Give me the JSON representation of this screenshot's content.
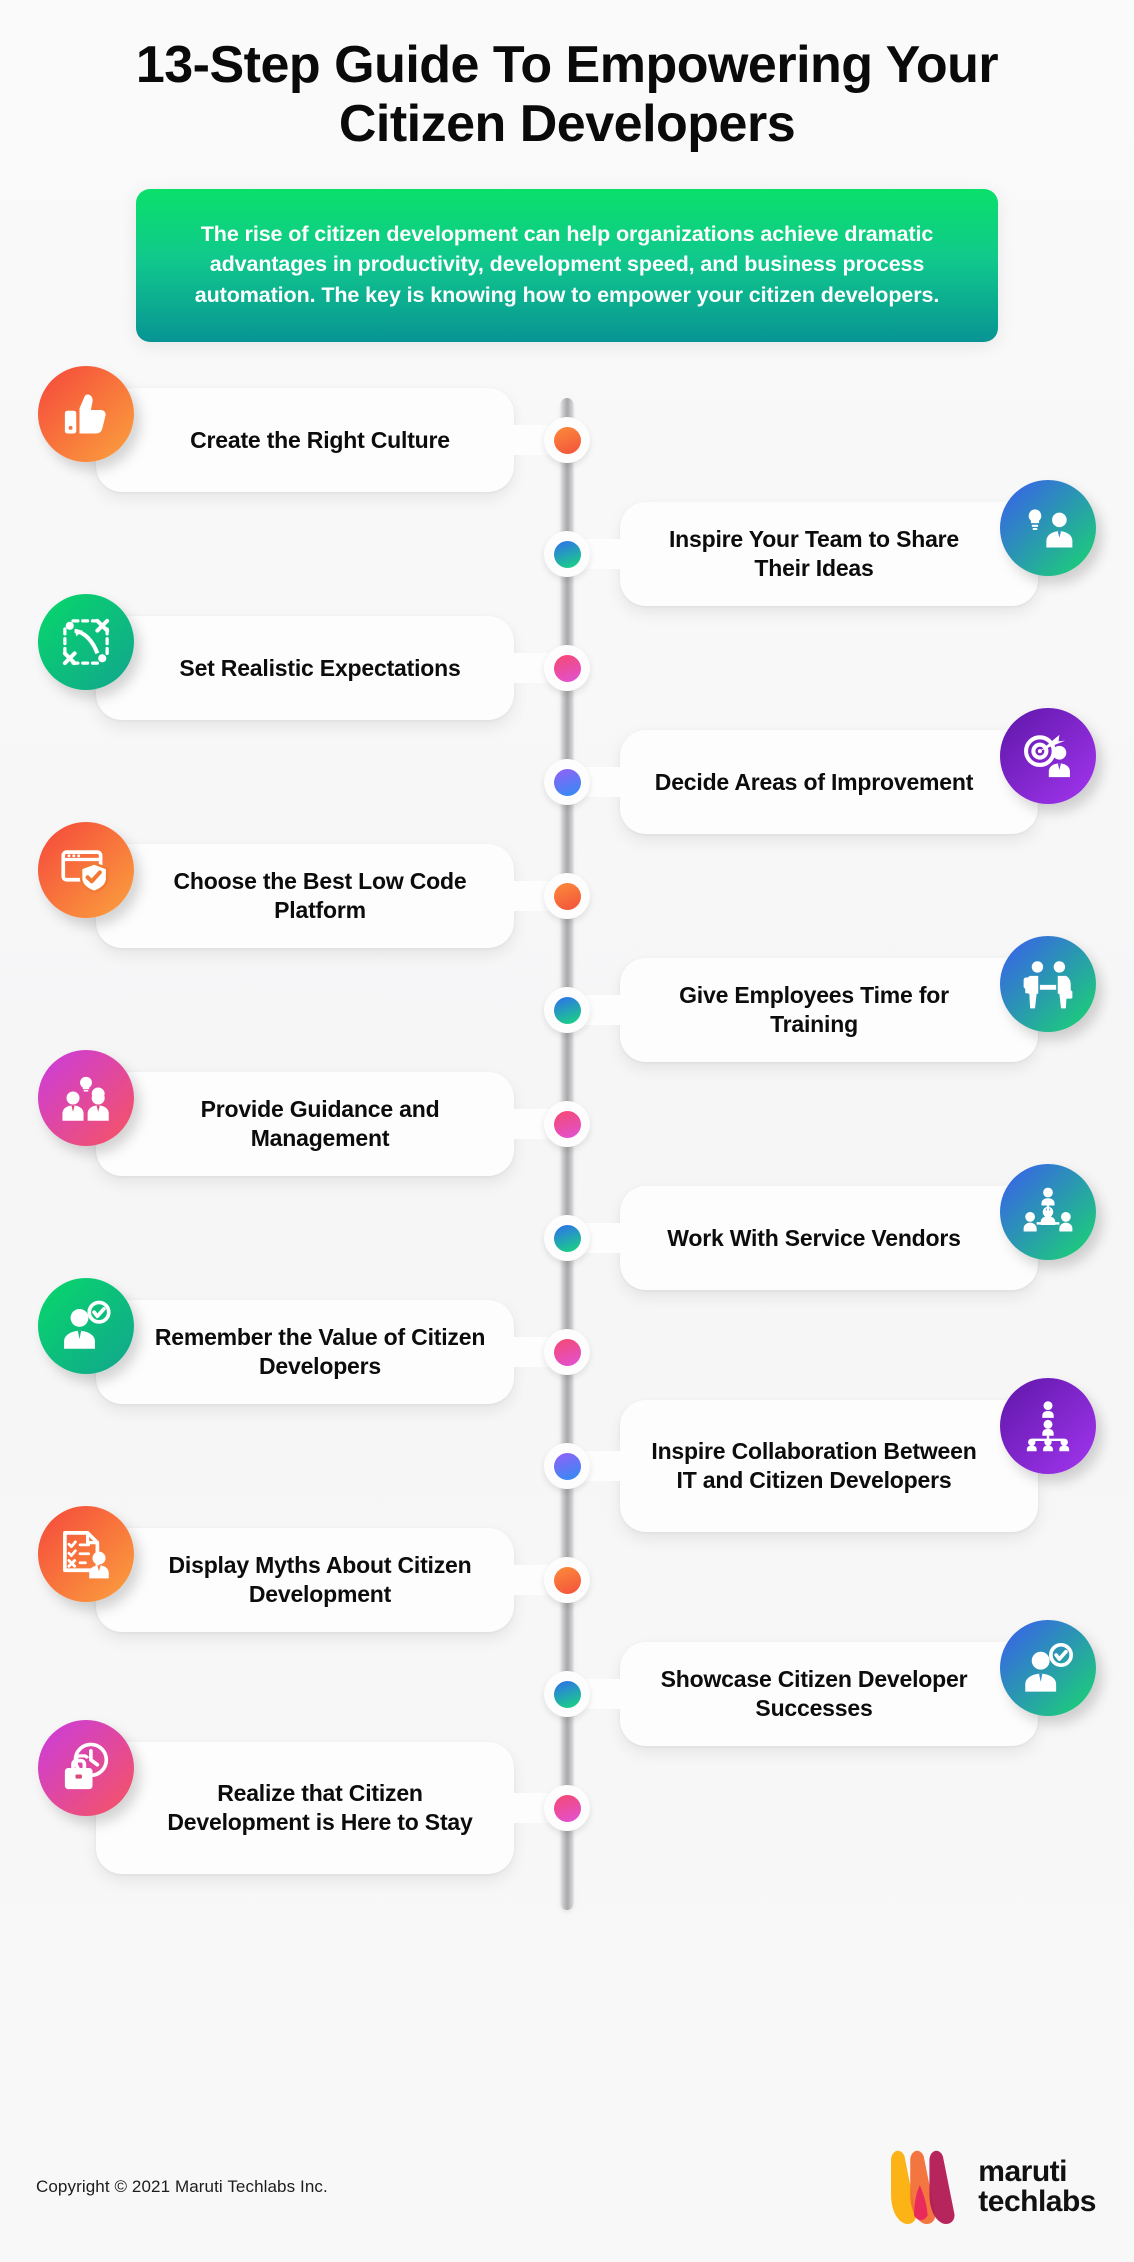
{
  "header": {
    "title": "13-Step Guide To Empowering Your Citizen Developers",
    "lead": "The rise of citizen development can help organizations achieve dramatic advantages in productivity, development speed, and business process automation. The key is knowing how to empower your citizen developers."
  },
  "theme": {
    "background": "#f7f7f8",
    "lead_gradient_from": "#0ae06a",
    "lead_gradient_to": "#089494",
    "spine_color": "#b0b0b3",
    "card_background": "#fdfdfd",
    "text_color": "#0c0c0c"
  },
  "steps": [
    {
      "label": "Create the Right Culture",
      "side": "left",
      "icon": "thumbs-up-icon",
      "icon_gradient_from": "#f5473c",
      "icon_gradient_to": "#fba23d",
      "dot_gradient_from": "#fb8c3a",
      "dot_gradient_to": "#f4513c"
    },
    {
      "label": "Inspire Your Team to Share Their Ideas",
      "side": "right",
      "icon": "lightbulb-person-icon",
      "icon_gradient_from": "#3a5bf0",
      "icon_gradient_to": "#19d86e",
      "dot_gradient_from": "#2f6df0",
      "dot_gradient_to": "#18d97c"
    },
    {
      "label": "Set Realistic Expectations",
      "side": "left",
      "icon": "scope-resize-icon",
      "icon_gradient_from": "#07d86a",
      "icon_gradient_to": "#12a58e",
      "dot_gradient_from": "#f6486e",
      "dot_gradient_to": "#e052d8"
    },
    {
      "label": "Decide Areas of Improvement",
      "side": "right",
      "icon": "target-person-icon",
      "icon_gradient_from": "#5e17a8",
      "icon_gradient_to": "#a335f0",
      "dot_gradient_from": "#9560f5",
      "dot_gradient_to": "#2f8df5"
    },
    {
      "label": "Choose the Best Low Code Platform",
      "side": "left",
      "icon": "browser-shield-icon",
      "icon_gradient_from": "#f5473c",
      "icon_gradient_to": "#fba23d",
      "dot_gradient_from": "#fb8c3a",
      "dot_gradient_to": "#f4513c"
    },
    {
      "label": "Give Employees Time for Training",
      "side": "right",
      "icon": "handshake-icon",
      "icon_gradient_from": "#3a5bf0",
      "icon_gradient_to": "#19d86e",
      "dot_gradient_from": "#2f6df0",
      "dot_gradient_to": "#18d97c"
    },
    {
      "label": "Provide Guidance and Management",
      "side": "left",
      "icon": "people-idea-icon",
      "icon_gradient_from": "#c93ce0",
      "icon_gradient_to": "#f7545f",
      "dot_gradient_from": "#f6486e",
      "dot_gradient_to": "#e052d8"
    },
    {
      "label": "Work With Service Vendors",
      "side": "right",
      "icon": "team-network-icon",
      "icon_gradient_from": "#3a5bf0",
      "icon_gradient_to": "#19d86e",
      "dot_gradient_from": "#2f6df0",
      "dot_gradient_to": "#18d97c"
    },
    {
      "label": "Remember the Value of Citizen Developers",
      "side": "left",
      "icon": "verified-person-icon",
      "icon_gradient_from": "#07d86a",
      "icon_gradient_to": "#12a58e",
      "dot_gradient_from": "#f6486e",
      "dot_gradient_to": "#e052d8"
    },
    {
      "label": "Inspire Collaboration Between IT and Citizen Developers",
      "side": "right",
      "icon": "org-chart-icon",
      "icon_gradient_from": "#5e17a8",
      "icon_gradient_to": "#a335f0",
      "dot_gradient_from": "#9560f5",
      "dot_gradient_to": "#2f8df5"
    },
    {
      "label": "Display Myths About Citizen Development",
      "side": "left",
      "icon": "checklist-person-icon",
      "icon_gradient_from": "#f5473c",
      "icon_gradient_to": "#fba23d",
      "dot_gradient_from": "#fb8c3a",
      "dot_gradient_to": "#f4513c"
    },
    {
      "label": "Showcase Citizen Developer Successes",
      "side": "right",
      "icon": "person-check-icon",
      "icon_gradient_from": "#3a5bf0",
      "icon_gradient_to": "#19d86e",
      "dot_gradient_from": "#2f6df0",
      "dot_gradient_to": "#18d97c"
    },
    {
      "label": "Realize that Citizen Development is Here to Stay",
      "side": "left",
      "icon": "clock-briefcase-icon",
      "icon_gradient_from": "#c93ce0",
      "icon_gradient_to": "#f7545f",
      "dot_gradient_from": "#f6486e",
      "dot_gradient_to": "#e052d8"
    }
  ],
  "footer": {
    "copyright": "Copyright © 2021 Maruti Techlabs Inc.",
    "logo_line1": "maruti",
    "logo_line2": "techlabs",
    "logo_colors": [
      "#fbb316",
      "#f26b32",
      "#e8245f",
      "#b21a54"
    ]
  }
}
